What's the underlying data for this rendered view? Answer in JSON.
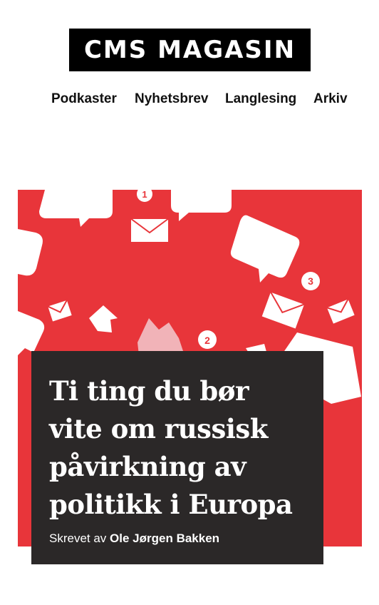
{
  "site": {
    "logo": "CMS MAGASIN"
  },
  "nav": {
    "items": [
      {
        "label": "Podkaster"
      },
      {
        "label": "Nyhetsbrev"
      },
      {
        "label": "Langlesing"
      },
      {
        "label": "Arkiv"
      }
    ]
  },
  "hero": {
    "badges": [
      "1",
      "2",
      "3"
    ],
    "colors": {
      "background": "#e8353a",
      "card": "#2b2828"
    }
  },
  "article": {
    "title": "Ti ting du bør vite om russisk påvirkning av politikk i Europa",
    "byline_prefix": "Skrevet av",
    "author": "Ole Jørgen Bakken"
  }
}
